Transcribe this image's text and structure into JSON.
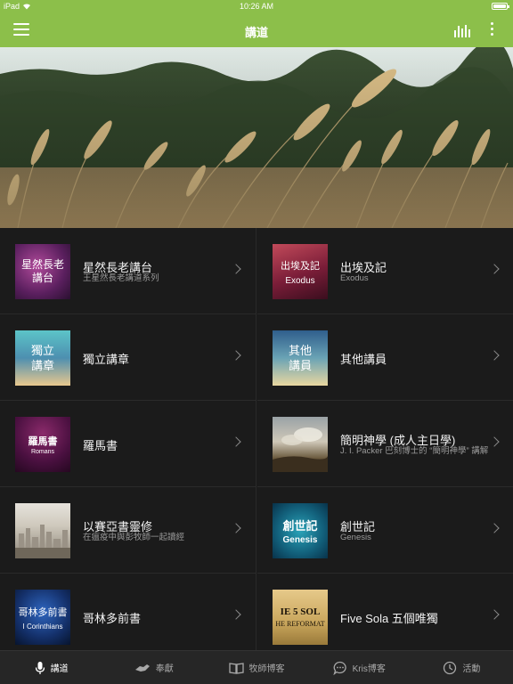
{
  "status_bar": {
    "device": "iPad",
    "time": "10:26 AM"
  },
  "nav": {
    "title": "講道"
  },
  "grid": [
    {
      "title": "星然長老講台",
      "subtitle": "王星然長老講道系列",
      "thumb_text": "星然長老\n講台"
    },
    {
      "title": "出埃及記",
      "subtitle": "Exodus",
      "thumb_text": "出埃及記",
      "thumb_sub": "Exodus"
    },
    {
      "title": "獨立講章",
      "subtitle": "",
      "thumb_text": "獨立\n講章"
    },
    {
      "title": "其他講員",
      "subtitle": "",
      "thumb_text": "其他\n講員"
    },
    {
      "title": "羅馬書",
      "subtitle": "",
      "thumb_text": "羅馬書",
      "thumb_sub": "Romans"
    },
    {
      "title": "簡明神學 (成人主日學)",
      "subtitle": "J. I. Packer 巴刻博士的 “簡明神學” 講解"
    },
    {
      "title": "以賽亞書靈修",
      "subtitle": "在瘟疫中與彭牧師一起讀經"
    },
    {
      "title": "創世記",
      "subtitle": "Genesis",
      "thumb_text": "創世記",
      "thumb_sub": "Genesis"
    },
    {
      "title": "哥林多前書",
      "subtitle": "",
      "thumb_text": "哥林多前書",
      "thumb_sub": "I Corinthians"
    },
    {
      "title": "Five Sola 五個唯獨",
      "subtitle": "",
      "thumb_text": "IE 5 SOL",
      "thumb_sub": "HE REFORMAT"
    }
  ],
  "tabs": [
    {
      "label": "講道",
      "icon": "microphone-icon"
    },
    {
      "label": "奉獻",
      "icon": "handshake-icon"
    },
    {
      "label": "牧師博客",
      "icon": "book-icon"
    },
    {
      "label": "Kris博客",
      "icon": "chat-icon"
    },
    {
      "label": "活動",
      "icon": "clock-icon"
    }
  ],
  "colors": {
    "nav_bg": "#8cbf4a",
    "background": "#1b1b1b",
    "tabbar_bg": "#262626"
  }
}
